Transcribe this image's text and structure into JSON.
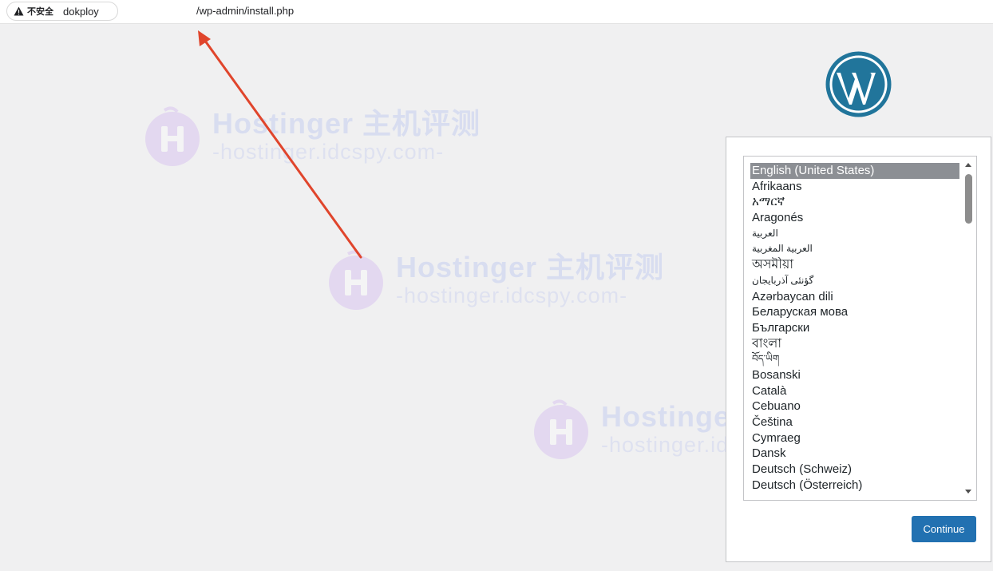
{
  "browser": {
    "security_label": "不安全",
    "url_host": "dokploy",
    "url_path": "/wp-admin/install.php"
  },
  "watermark": {
    "title": "Hostinger 主机评测",
    "subtitle": "-hostinger.idcspy.com-"
  },
  "setup": {
    "languages": [
      "English (United States)",
      "Afrikaans",
      "አማርኛ",
      "Aragonés",
      "العربية",
      "العربية المغربية",
      "অসমীয়া",
      "گؤنئی آذربایجان",
      "Azərbaycan dili",
      "Беларуская мова",
      "Български",
      "বাংলা",
      "བོད་ཡིག",
      "Bosanski",
      "Català",
      "Cebuano",
      "Čeština",
      "Cymraeg",
      "Dansk",
      "Deutsch (Schweiz)",
      "Deutsch (Österreich)"
    ],
    "selected_language": "English (United States)",
    "continue_label": "Continue"
  },
  "colors": {
    "wp_blue": "#2271b1",
    "wp_logo_blue": "#21759b",
    "arrow_red": "#e0452c"
  }
}
